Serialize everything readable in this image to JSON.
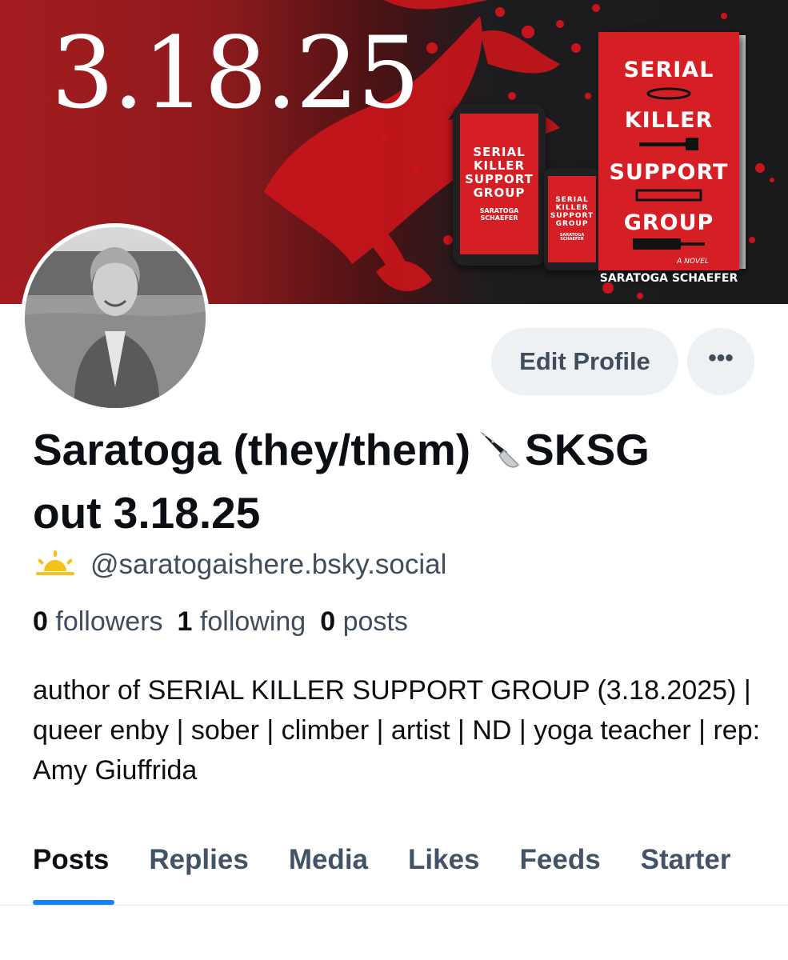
{
  "banner": {
    "release_date": "3.18.25",
    "book": {
      "title_lines": [
        "SERIAL",
        "KILLER",
        "SUPPORT",
        "GROUP"
      ],
      "subtitle": "A NOVEL",
      "author": "SARATOGA SCHAEFER"
    }
  },
  "profile": {
    "display_name_part1": "Saratoga (they/them)",
    "display_name_part2": "SKSG",
    "display_name_part3": "out 3.18.25",
    "handle_emoji_icon": "sun-behind-horizon-icon",
    "handle": "@saratogaishere.bsky.social",
    "stats": {
      "followers_count": "0",
      "followers_label": "followers",
      "following_count": "1",
      "following_label": "following",
      "posts_count": "0",
      "posts_label": "posts"
    },
    "bio": "author of SERIAL KILLER SUPPORT GROUP (3.18.2025) | queer enby | sober | climber | artist | ND | yoga teacher | rep: Amy Giuffrida"
  },
  "actions": {
    "edit_profile_label": "Edit Profile",
    "more_label": "•••"
  },
  "tabs": [
    {
      "label": "Posts"
    },
    {
      "label": "Replies"
    },
    {
      "label": "Media"
    },
    {
      "label": "Likes"
    },
    {
      "label": "Feeds"
    },
    {
      "label": "Starter"
    }
  ],
  "colors": {
    "accent": "#1083fe",
    "banner_red": "#a41c1f",
    "book_red": "#d51f25",
    "muted_text": "#3f4d5c"
  }
}
